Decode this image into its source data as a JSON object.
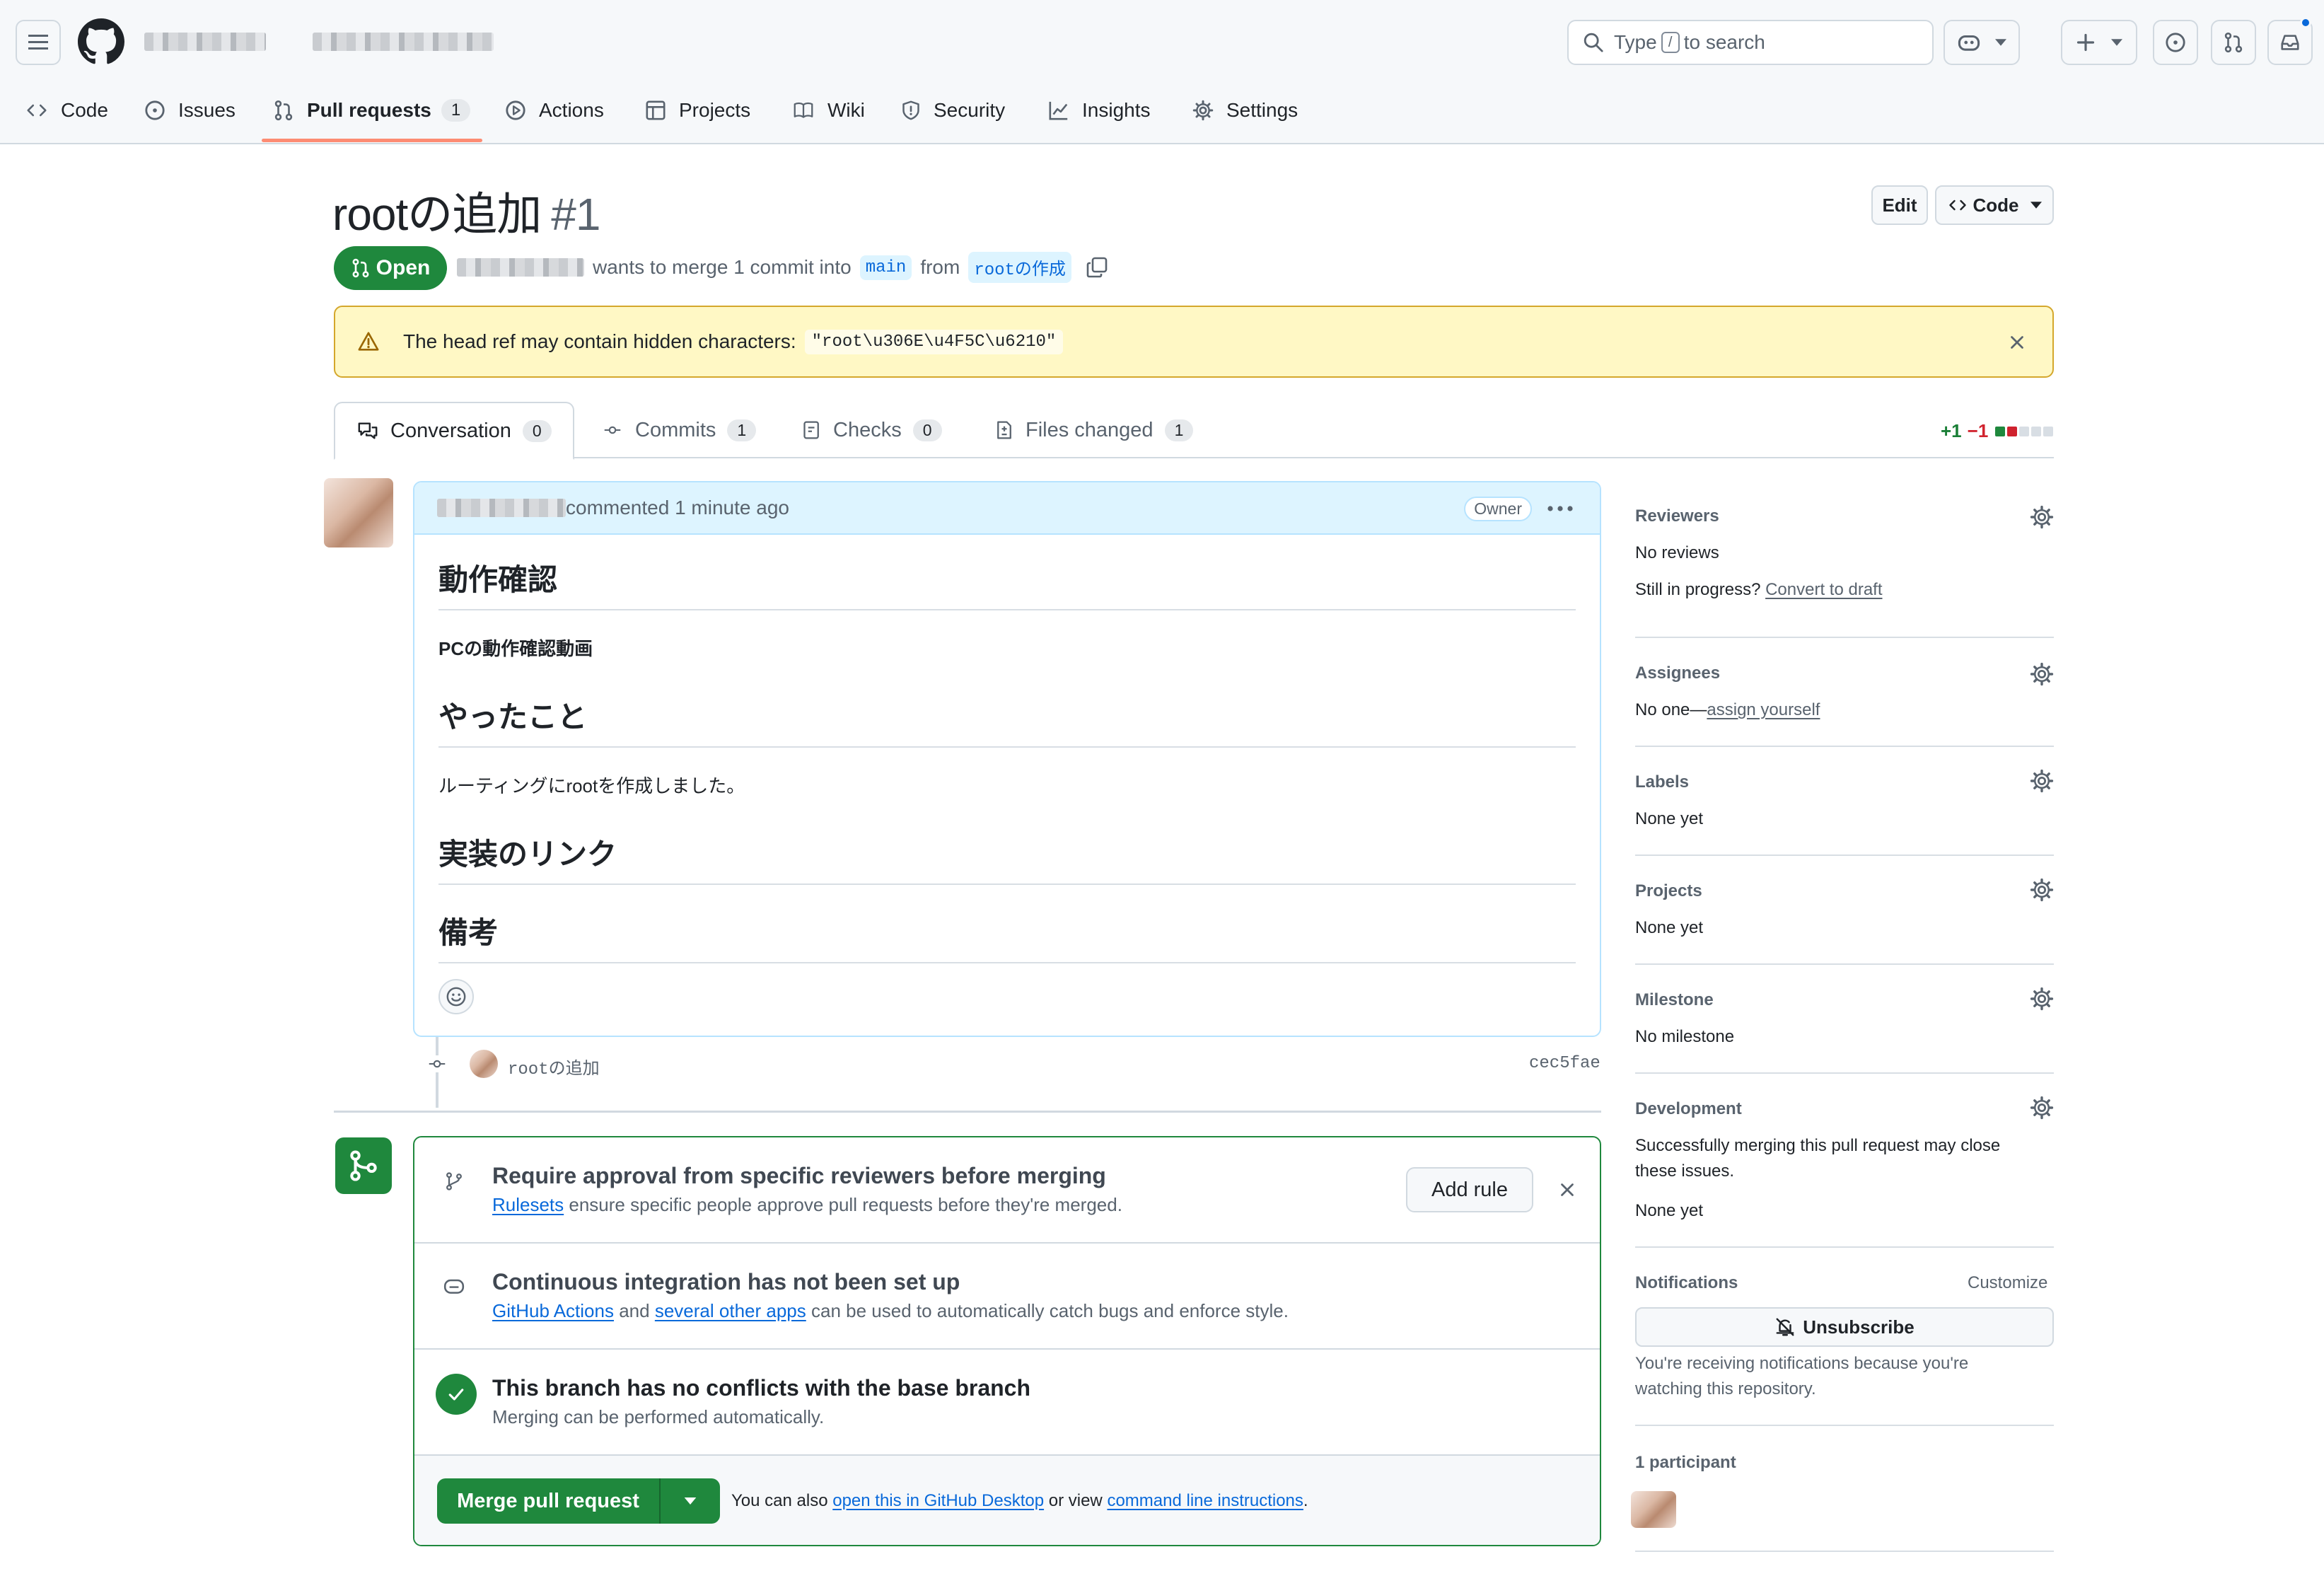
{
  "header": {
    "search_prefix": "Type",
    "search_key": "/",
    "search_suffix": "to search"
  },
  "nav": {
    "code": "Code",
    "issues": "Issues",
    "pull_requests": "Pull requests",
    "pull_requests_count": "1",
    "actions": "Actions",
    "projects": "Projects",
    "wiki": "Wiki",
    "security": "Security",
    "insights": "Insights",
    "settings": "Settings"
  },
  "pr": {
    "title": "rootの追加",
    "number": "#1",
    "edit_label": "Edit",
    "code_label": "Code",
    "state": "Open",
    "meta_text": "wants to merge 1 commit into",
    "base_branch": "main",
    "from_text": "from",
    "head_branch": "rootの作成"
  },
  "warning": {
    "text": "The head ref may contain hidden characters:",
    "code": "\"root\\u306E\\u4F5C\\u6210\""
  },
  "tabs": [
    {
      "label": "Conversation",
      "count": "0"
    },
    {
      "label": "Commits",
      "count": "1"
    },
    {
      "label": "Checks",
      "count": "0"
    },
    {
      "label": "Files changed",
      "count": "1"
    }
  ],
  "diffstat": {
    "added": "+1",
    "removed": "−1"
  },
  "comment": {
    "header_text": "commented 1 minute ago",
    "owner_badge": "Owner",
    "h1": "動作確認",
    "p1": "PCの動作確認動画",
    "h2": "やったこと",
    "p2": "ルーティングにrootを作成しました。",
    "h3": "実装のリンク",
    "h4": "備考"
  },
  "commit": {
    "message": "rootの追加",
    "sha": "cec5fae"
  },
  "merge": {
    "rule_title": "Require approval from specific reviewers before merging",
    "rule_link": "Rulesets",
    "rule_text": "ensure specific people approve pull requests before they're merged.",
    "add_rule": "Add rule",
    "ci_title": "Continuous integration has not been set up",
    "ci_link1": "GitHub Actions",
    "ci_and": "and",
    "ci_link2": "several other apps",
    "ci_text": "can be used to automatically catch bugs and enforce style.",
    "conflict_title": "This branch has no conflicts with the base branch",
    "conflict_text": "Merging can be performed automatically.",
    "merge_button": "Merge pull request",
    "also_text": "You can also",
    "desktop_link": "open this in GitHub Desktop",
    "or_view": "or view",
    "cli_link": "command line instructions",
    "period": "."
  },
  "sidebar": {
    "reviewers_h": "Reviewers",
    "reviewers_v": "No reviews",
    "still_in_progress": "Still in progress?",
    "convert_draft": "Convert to draft",
    "assignees_h": "Assignees",
    "assignees_prefix": "No one—",
    "assign_yourself": "assign yourself",
    "labels_h": "Labels",
    "labels_v": "None yet",
    "projects_h": "Projects",
    "projects_v": "None yet",
    "milestone_h": "Milestone",
    "milestone_v": "No milestone",
    "development_h": "Development",
    "development_t1": "Successfully merging this pull request may close",
    "development_t2": "these issues.",
    "development_v": "None yet",
    "notifications_h": "Notifications",
    "customize": "Customize",
    "unsubscribe": "Unsubscribe",
    "notif_t1": "You're receiving notifications because you're",
    "notif_t2": "watching this repository.",
    "participants_h": "1 participant"
  },
  "colors": {
    "accent_green": "#1f883d",
    "link_blue": "#0969da",
    "warning_bg": "#fff8c5"
  }
}
